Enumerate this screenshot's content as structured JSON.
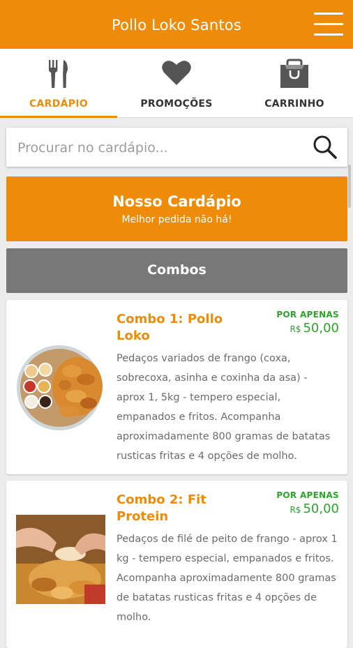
{
  "header": {
    "title": "Pollo Loko Santos"
  },
  "tabs": [
    {
      "label": "CARDÁPIO",
      "icon": "cutlery-icon",
      "active": true
    },
    {
      "label": "PROMOÇÕES",
      "icon": "heart-icon",
      "active": false
    },
    {
      "label": "CARRINHO",
      "icon": "shopping-bag-icon",
      "active": false
    }
  ],
  "search": {
    "placeholder": "Procurar no cardápio...",
    "value": ""
  },
  "banner": {
    "title": "Nosso Cardápio",
    "subtitle": "Melhor pedida não há!"
  },
  "section": {
    "label": "Combos"
  },
  "items": [
    {
      "name": "Combo 1: Pollo Loko",
      "price_prefix": "POR APENAS",
      "currency": "R$",
      "price": "50,00",
      "description": "Pedaços variados de frango (coxa, sobrecoxa, asinha e coxinha da asa) - aprox 1, 5kg - tempero especial, empanados e fritos. Acompanha aproximadamente 800 gramas de batatas rusticas fritas e 4 opções de molho."
    },
    {
      "name": "Combo 2: Fit Protein",
      "price_prefix": "POR APENAS",
      "currency": "R$",
      "price": "50,00",
      "description": "Pedaços de filé de peito de frango - aprox 1 kg - tempero especial, empanados e fritos. Acompanha aproximadamente 800 gramas de batatas rusticas fritas e 4 opções de molho."
    }
  ],
  "colors": {
    "brand": "#ee8c0a",
    "price": "#2aa52a",
    "section": "#787878"
  }
}
